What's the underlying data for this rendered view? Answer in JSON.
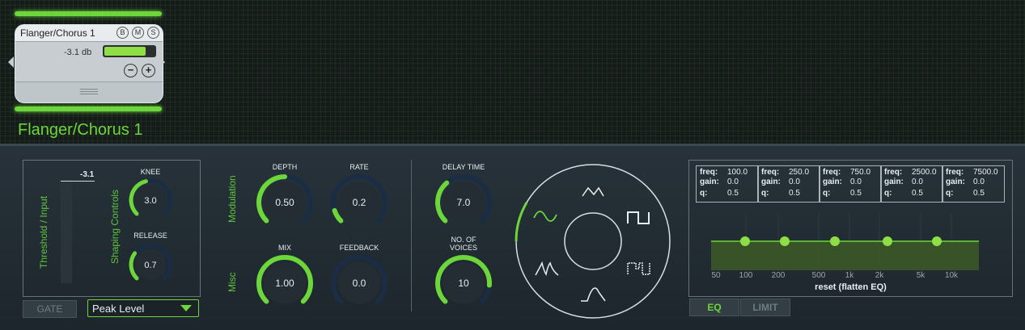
{
  "colors": {
    "accent": "#6cd63b",
    "panel": "#1e262b",
    "track": "#1b2d44"
  },
  "node": {
    "title": "Flanger/Chorus 1",
    "buttons": [
      "B",
      "M",
      "S"
    ],
    "db": "-3.1 db",
    "level_fraction": 0.82,
    "minus": "−",
    "plus": "+",
    "label": "Flanger/Chorus 1"
  },
  "gate": {
    "threshold_label": "Threshold / Input",
    "threshold_value": "-3.1",
    "shaping_label": "Shaping Controls",
    "knee": {
      "label": "KNEE",
      "value": "3.0",
      "fraction": 0.45
    },
    "release": {
      "label": "RELEASE",
      "value": "0.7",
      "fraction": 0.3
    },
    "gate_button": "GATE",
    "mode_select": "Peak Level"
  },
  "modulation": {
    "label": "Modulation",
    "depth": {
      "label": "DEPTH",
      "value": "0.50",
      "fraction": 0.5
    },
    "rate": {
      "label": "RATE",
      "value": "0.2",
      "fraction": 0.1
    }
  },
  "misc": {
    "label": "Misc",
    "mix": {
      "label": "MIX",
      "value": "1.00",
      "fraction": 1.0
    },
    "feedback": {
      "label": "FEEDBACK",
      "value": "0.0",
      "fraction": 0.0
    }
  },
  "delay": {
    "delay_time": {
      "label": "DELAY TIME",
      "value": "7.0",
      "fraction": 0.35
    },
    "voices": {
      "label_line1": "NO. OF",
      "label_line2": "VOICES",
      "value": "10",
      "fraction": 0.85
    }
  },
  "waveforms": [
    "triangle-wave-icon",
    "square-wave-icon",
    "stepped-wave-icon",
    "ramp-wave-icon",
    "peaks-wave-icon",
    "sine-wave-icon"
  ],
  "selected_waveform": "sine-wave-icon",
  "eq": {
    "bands": [
      {
        "freq": "100.0",
        "gain": "0.0",
        "q": "0.5"
      },
      {
        "freq": "250.0",
        "gain": "0.0",
        "q": "0.5"
      },
      {
        "freq": "750.0",
        "gain": "0.0",
        "q": "0.5"
      },
      {
        "freq": "2500.0",
        "gain": "0.0",
        "q": "0.5"
      },
      {
        "freq": "7500.0",
        "gain": "0.0",
        "q": "0.5"
      }
    ],
    "labels": {
      "freq": "freq:",
      "gain": "gain:",
      "q": "q:"
    },
    "axis_ticks": [
      "50",
      "100",
      "200",
      "500",
      "1k",
      "2k",
      "5k",
      "10k"
    ],
    "reset": "reset (flatten EQ)",
    "eq_button": "EQ",
    "limit_button": "LIMIT"
  }
}
